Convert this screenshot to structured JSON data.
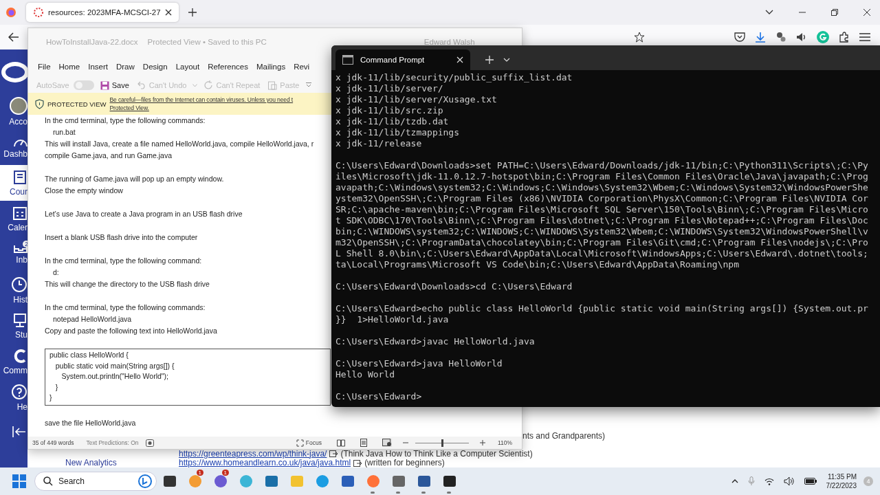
{
  "browser": {
    "tab_title": "resources: 2023MFA-MCSCI-27",
    "nav": [
      {
        "label": "Acco",
        "kind": "account",
        "selected": false
      },
      {
        "label": "Dashb",
        "kind": "dashboard",
        "selected": false
      },
      {
        "label": "Cour",
        "kind": "courses",
        "selected": true
      },
      {
        "label": "Caler",
        "kind": "calendar",
        "selected": false
      },
      {
        "label": "Inb",
        "kind": "inbox",
        "selected": false,
        "badge": "2"
      },
      {
        "label": "Hist",
        "kind": "history",
        "selected": false
      },
      {
        "label": "Stu",
        "kind": "studio",
        "selected": false
      },
      {
        "label": "Comm",
        "kind": "commons",
        "selected": false
      },
      {
        "label": "He",
        "kind": "help",
        "selected": false
      }
    ],
    "page": {
      "fragment": "nts and Grandparents)",
      "nav_link": "New Analytics",
      "links": [
        {
          "url": "https://greenteapress.com/wp/think-java/",
          "note": "(Think Java How to Think Like a Computer Scientist)"
        },
        {
          "url": "https://www.homeandlearn.co.uk/java/java.html",
          "note": "(written for beginners)"
        }
      ]
    }
  },
  "word": {
    "file": "HowToInstallJava-22.docx",
    "status": "Protected View • Saved to this PC",
    "user": "Edward Walsh",
    "menu": [
      "File",
      "Home",
      "Insert",
      "Draw",
      "Design",
      "Layout",
      "References",
      "Mailings",
      "Revi"
    ],
    "quick": {
      "autosave": "AutoSave",
      "autosave_on": false,
      "save": "Save",
      "undo": "Can't Undo",
      "repeat": "Can't Repeat",
      "paste": "Paste"
    },
    "protected": {
      "label": "PROTECTED VIEW",
      "message": "Be careful—files from the Internet can contain viruses. Unless you need t",
      "message_end": "Protected View."
    },
    "doc": [
      [
        {
          "kind": "text",
          "text": "In the cmd terminal, type the following commands:"
        },
        {
          "kind": "command",
          "text": "run.bat"
        },
        {
          "kind": "text",
          "text": "This will install Java, create a file named HelloWorld.java, compile HelloWorld.java, r"
        },
        {
          "kind": "text",
          "text": "compile Game.java, and run Game.java"
        }
      ],
      [
        {
          "kind": "text",
          "text": "The running of Game.java will pop up an empty window."
        },
        {
          "kind": "text",
          "text": "Close the empty window"
        }
      ],
      [
        {
          "kind": "text",
          "text": "Let’s use Java to create a Java program in an USB flash drive"
        }
      ],
      [
        {
          "kind": "text",
          "text": "Insert a blank USB flash drive into the computer"
        }
      ],
      [
        {
          "kind": "text",
          "text": "In the cmd terminal, type the following command:"
        },
        {
          "kind": "command",
          "text": "d:"
        },
        {
          "kind": "text",
          "text": "This will change the directory to the USB flash drive"
        }
      ],
      [
        {
          "kind": "text",
          "text": "In the cmd terminal, type the following commands:"
        },
        {
          "kind": "command",
          "text": "notepad HelloWorld.java"
        },
        {
          "kind": "text",
          "text": "Copy and paste the following text into HelloWorld.java"
        }
      ],
      [
        {
          "kind": "code",
          "lines": [
            "public class HelloWorld {",
            "   public static void main(String args[]) {",
            "      System.out.println(\"Hello World\");",
            "   }",
            "}"
          ]
        }
      ],
      [
        {
          "kind": "text",
          "text": "save the file HelloWorld.java"
        }
      ]
    ],
    "status_bar": {
      "words": "35 of 449 words",
      "predictions": "Text Predictions: On",
      "focus": "Focus",
      "zoom": "110%",
      "level": 0.5
    }
  },
  "terminal": {
    "title": "Command Prompt",
    "blocks": [
      [
        "x jdk-11/lib/security/public_suffix_list.dat",
        "x jdk-11/lib/server/",
        "x jdk-11/lib/server/Xusage.txt",
        "x jdk-11/lib/src.zip",
        "x jdk-11/lib/tzdb.dat",
        "x jdk-11/lib/tzmappings",
        "x jdk-11/release"
      ],
      [
        "C:\\Users\\Edward\\Downloads>set PATH=C:\\Users\\Edward/Downloads/jdk-11/bin;C:\\Python311\\Scripts\\;C:\\Py",
        "iles\\Microsoft\\jdk-11.0.12.7-hotspot\\bin;C:\\Program Files\\Common Files\\Oracle\\Java\\javapath;C:\\Prog",
        "avapath;C:\\Windows\\system32;C:\\Windows;C:\\Windows\\System32\\Wbem;C:\\Windows\\System32\\WindowsPowerShe",
        "ystem32\\OpenSSH\\;C:\\Program Files (x86)\\NVIDIA Corporation\\PhysX\\Common;C:\\Program Files\\NVIDIA Cor",
        "SR;C:\\apache-maven\\bin;C:\\Program Files\\Microsoft SQL Server\\150\\Tools\\Binn\\;C:\\Program Files\\Micro",
        "t SDK\\ODBC\\170\\Tools\\Binn\\;C:\\Program Files\\dotnet\\;C:\\Program Files\\Notepad++;C:\\Program Files\\Doc",
        "bin;C:\\WINDOWS\\system32;C:\\WINDOWS;C:\\WINDOWS\\System32\\Wbem;C:\\WINDOWS\\System32\\WindowsPowerShell\\v",
        "m32\\OpenSSH\\;C:\\ProgramData\\chocolatey\\bin;C:\\Program Files\\Git\\cmd;C:\\Program Files\\nodejs\\;C:\\Pro",
        "L Shell 8.0\\bin\\;C:\\Users\\Edward\\AppData\\Local\\Microsoft\\WindowsApps;C:\\Users\\Edward\\.dotnet\\tools;",
        "ta\\Local\\Programs\\Microsoft VS Code\\bin;C:\\Users\\Edward\\AppData\\Roaming\\npm"
      ],
      [
        "C:\\Users\\Edward\\Downloads>cd C:\\Users\\Edward"
      ],
      [
        "C:\\Users\\Edward>echo public class HelloWorld {public static void main(String args[]) {System.out.pr",
        "}}  1>HelloWorld.java"
      ],
      [
        "C:\\Users\\Edward>javac HelloWorld.java"
      ],
      [
        "C:\\Users\\Edward>java HelloWorld",
        "Hello World"
      ],
      [
        "C:\\Users\\Edward>"
      ]
    ]
  },
  "taskbar": {
    "search": "Search",
    "apps": [
      {
        "kind": "taskview",
        "running": false
      },
      {
        "kind": "widget",
        "running": false,
        "badge": "1"
      },
      {
        "kind": "chat",
        "running": false,
        "badge": "1"
      },
      {
        "kind": "ring",
        "running": false
      },
      {
        "kind": "video",
        "running": false
      },
      {
        "kind": "folder",
        "running": false
      },
      {
        "kind": "edge",
        "running": false
      },
      {
        "kind": "store",
        "running": false
      },
      {
        "kind": "firefox",
        "running": true
      },
      {
        "kind": "screen",
        "running": true
      },
      {
        "kind": "word",
        "running": true
      },
      {
        "kind": "terminal",
        "running": true
      }
    ],
    "time": "11:35 PM",
    "date": "7/22/2023",
    "notifications": "4"
  }
}
